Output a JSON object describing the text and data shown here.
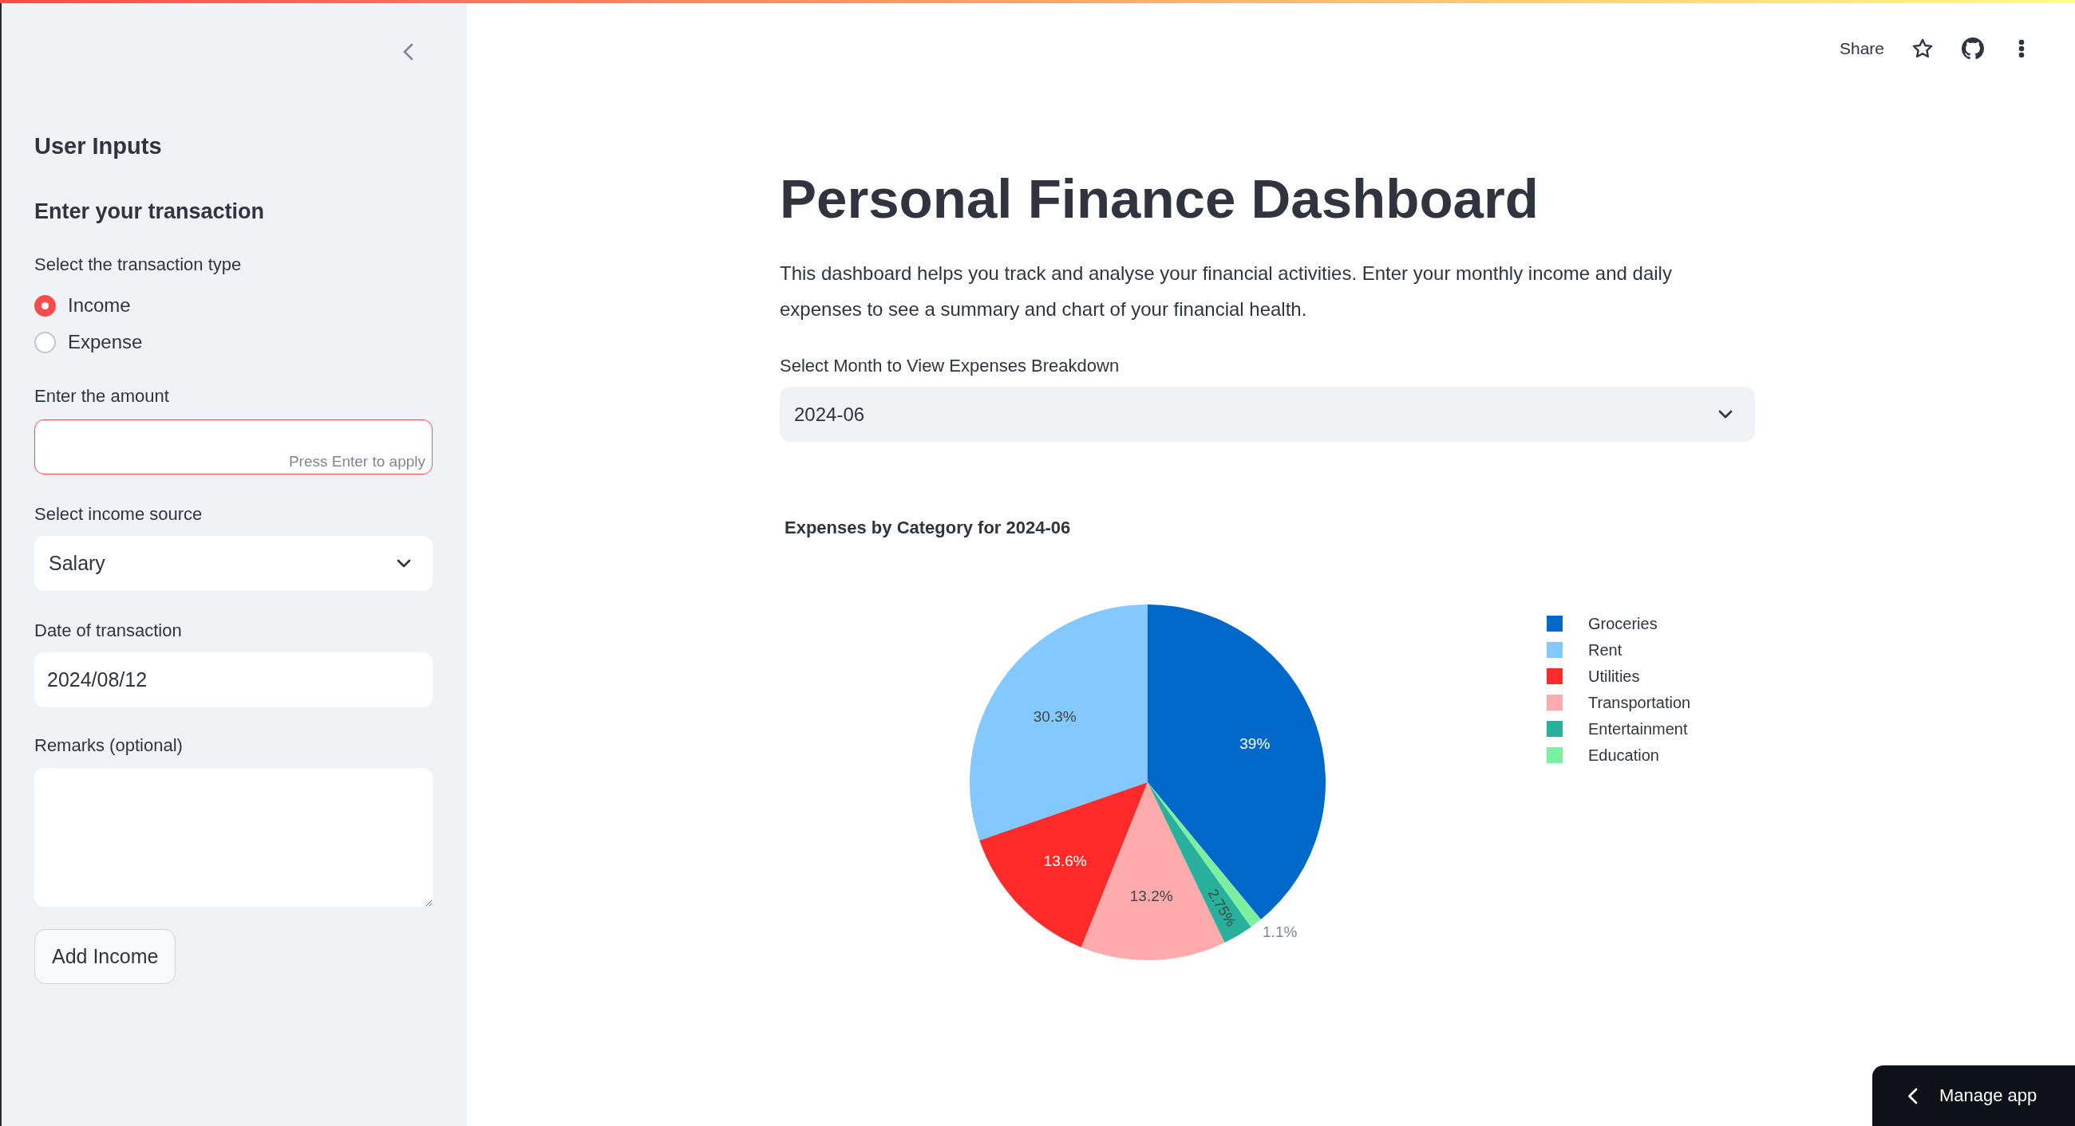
{
  "sidebar": {
    "title": "User Inputs",
    "subtitle": "Enter your transaction",
    "transaction_type": {
      "label": "Select the transaction type",
      "options": [
        {
          "label": "Income",
          "selected": true
        },
        {
          "label": "Expense",
          "selected": false
        }
      ]
    },
    "amount": {
      "label": "Enter the amount",
      "hint": "Press Enter to apply",
      "focused": true
    },
    "income_source": {
      "label": "Select income source",
      "value": "Salary"
    },
    "date": {
      "label": "Date of transaction",
      "value": "2024/08/12"
    },
    "remarks": {
      "label": "Remarks (optional)"
    },
    "button": "Add Income"
  },
  "header": {
    "share": "Share"
  },
  "main": {
    "title": "Personal Finance Dashboard",
    "description": "This dashboard helps you track and analyse your financial activities. Enter your monthly income and daily expenses to see a summary and chart of your financial health.",
    "month_select": {
      "label": "Select Month to View Expenses Breakdown",
      "value": "2024-06"
    },
    "chart_data": [
      {
        "type": "pie",
        "title": "Expenses by Category for 2024-06",
        "categories": [
          "Groceries",
          "Rent",
          "Utilities",
          "Transportation",
          "Entertainment",
          "Education"
        ],
        "values": [
          39,
          30.3,
          13.6,
          13.2,
          2.75,
          1.1
        ],
        "colors": [
          "#0068c9",
          "#83c9ff",
          "#ff2b2b",
          "#ffabab",
          "#29b09d",
          "#7defa1"
        ],
        "value_labels": [
          "39%",
          "30.3%",
          "13.6%",
          "13.2%",
          "2.75%",
          "1.1%"
        ],
        "legend": "right"
      }
    ]
  },
  "manage_app": "Manage app"
}
